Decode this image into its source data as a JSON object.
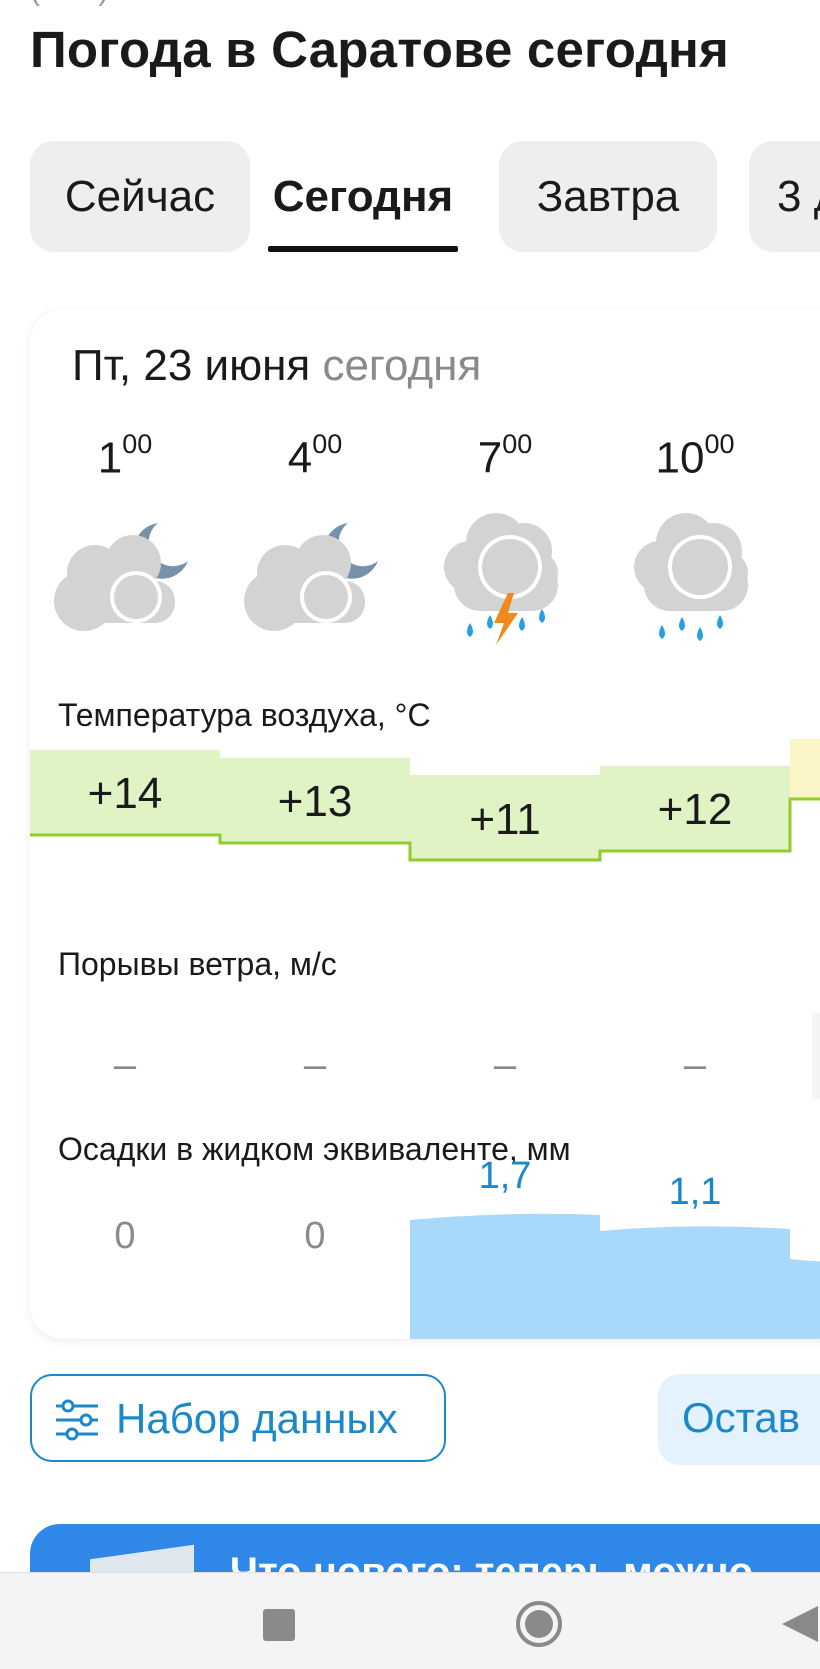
{
  "page": {
    "top_cut_text": "(... ...)",
    "title": "Погода в Саратове сегодня"
  },
  "tabs": [
    {
      "label": "Сейчас",
      "active": false
    },
    {
      "label": "Сегодня",
      "active": true
    },
    {
      "label": "Завтра",
      "active": false
    },
    {
      "label": "3 д",
      "active": false
    }
  ],
  "card": {
    "date": "Пт, 23 июня",
    "date_suffix": "сегодня",
    "hours": [
      {
        "h": "1",
        "m": "00",
        "icon": "cloud-moon-icon"
      },
      {
        "h": "4",
        "m": "00",
        "icon": "cloud-moon-icon"
      },
      {
        "h": "7",
        "m": "00",
        "icon": "thunderstorm-rain-icon"
      },
      {
        "h": "10",
        "m": "00",
        "icon": "rain-cloud-icon"
      }
    ],
    "temperature_label": "Температура воздуха, °C",
    "temperatures": [
      "+14",
      "+13",
      "+11",
      "+12"
    ],
    "wind_label": "Порывы ветра, м/с",
    "wind": [
      "–",
      "–",
      "–",
      "–"
    ],
    "precip_label": "Осадки в жидком эквиваленте, мм",
    "precip": [
      "0",
      "0",
      "1,7",
      "1,1"
    ]
  },
  "buttons": {
    "data_set": "Набор данных",
    "leave": "Остав"
  },
  "promo": {
    "text": "Что нового: теперь можно"
  },
  "colors": {
    "accent_blue": "#1b88c9",
    "temp_fill": "#dff3c4",
    "temp_line": "#8fcc2e",
    "precip_fill": "#a8d8fa",
    "precip_text": "#1b88c9",
    "icon_cloud": "#d3d3d3",
    "icon_moon": "#7891ab",
    "rain_drop": "#27a0e0",
    "lightning": "#f08a1c"
  }
}
